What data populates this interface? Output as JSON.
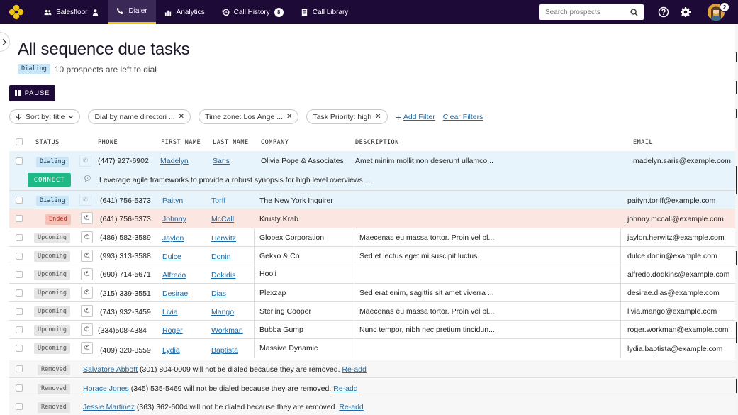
{
  "nav": {
    "items": [
      {
        "label": "Salesfloor",
        "icon": "group-icon"
      },
      {
        "label": "Dialer",
        "icon": "phone-icon",
        "active": true
      },
      {
        "label": "Analytics",
        "icon": "bar-chart-icon"
      },
      {
        "label": "Call History",
        "icon": "history-icon",
        "badge": "8"
      },
      {
        "label": "Call Library",
        "icon": "library-icon"
      }
    ],
    "search_placeholder": "Search prospects",
    "avatar_badge": "2",
    "colors": {
      "bg": "#1d0a36",
      "active_underline": "#f1c40f",
      "logo": "#f1c40f"
    }
  },
  "page": {
    "title": "All sequence due tasks",
    "status_tag": "Dialing",
    "status_text": "10 prospects are left to dial",
    "pause_label": "PAUSE"
  },
  "filters": {
    "sort": "Sort by: title",
    "chips": [
      "Dial by name directori ...",
      "Time zone: Los Ange ...",
      "Task Priority: high"
    ],
    "add_filter": "Add Filter",
    "clear_filters": "Clear Filters"
  },
  "table": {
    "headers": {
      "status": "STATUS",
      "phone": "PHONE",
      "first_name": "FIRST NAME",
      "last_name": "LAST NAME",
      "company": "COMPANY",
      "description": "DESCRIPTION",
      "email": "EMAIL"
    },
    "rows": [
      {
        "status": "Dialing",
        "phone": "(447) 927-6902",
        "first": "Madelyn",
        "last": "Saris",
        "company": "Olivia Pope & Associates",
        "description": "Amet minim mollit non deserunt ullamco...",
        "email": "madelyn.saris@example.com"
      },
      {
        "status": "Dialing",
        "phone": "(641) 756-5373",
        "first": "Paityn",
        "last": "Torff",
        "company": "The New York Inquirer",
        "description": "",
        "email": "paityn.toriff@example.com"
      },
      {
        "status": "Ended",
        "phone": "(641) 756-5373",
        "first": "Johnny",
        "last": "McCall",
        "company": "Krusty Krab",
        "description": "",
        "email": "johnny.mccall@example.com"
      },
      {
        "status": "Upcoming",
        "phone": "(486) 582-3589",
        "first": "Jaylon",
        "last": "Herwitz",
        "company": "Globex Corporation",
        "description": "Maecenas eu massa tortor. Proin vel bl...",
        "email": "jaylon.herwitz@example.com"
      },
      {
        "status": "Upcoming",
        "phone": "(993) 313-3588",
        "first": "Dulce",
        "last": "Donin",
        "company": "Gekko & Co",
        "description": "Sed et lectus eget mi suscipit luctus.",
        "email": "dulce.donin@example.com"
      },
      {
        "status": "Upcoming",
        "phone": "(690) 714-5671",
        "first": "Alfredo",
        "last": "Dokidis",
        "company": "Hooli",
        "description": "",
        "email": "alfredo.dodkins@example.com"
      },
      {
        "status": "Upcoming",
        "phone": "(215) 339-3551",
        "first": "Desirae",
        "last": "Dias",
        "company": "Plexzap",
        "description": "Sed erat enim, sagittis sit amet viverra ...",
        "email": "desirae.dias@example.com"
      },
      {
        "status": "Upcoming",
        "phone": "(743) 932-3459",
        "first": "Livia",
        "last": "Mango",
        "company": "Sterling Cooper",
        "description": "Maecenas eu massa tortor. Proin vel bl...",
        "email": "livia.mango@example.com"
      },
      {
        "status": "Upcoming",
        "phone": "(334)508-4384",
        "first": "Roger",
        "last": "Workman",
        "company": "Bubba Gump",
        "description": "Nunc tempor, nibh nec pretium tincidun...",
        "email": "roger.workman@example.com"
      },
      {
        "status": "Upcoming",
        "phone": "(409) 320-3559",
        "first": "Lydia",
        "last": "Baptista",
        "company": "Massive Dynamic",
        "description": "",
        "email": "lydia.baptista@example.com"
      }
    ],
    "connect_label": "CONNECT",
    "connect_message": "Leverage agile frameworks to provide a robust synopsis for high level overviews ...",
    "removed": [
      {
        "status": "Removed",
        "name": "Salvatore Abbott",
        "text": "(301) 804-0009 will not be dialed because they are removed.",
        "action": "Re-add"
      },
      {
        "status": "Removed",
        "name": "Horace Jones",
        "text": "(345) 535-5469 will not be dialed because they are removed.",
        "action": "Re-add"
      },
      {
        "status": "Removed",
        "name": "Jessie Martinez",
        "text": "(363) 362-6004 will not be dialed because they are removed.",
        "action": "Re-add"
      }
    ]
  }
}
